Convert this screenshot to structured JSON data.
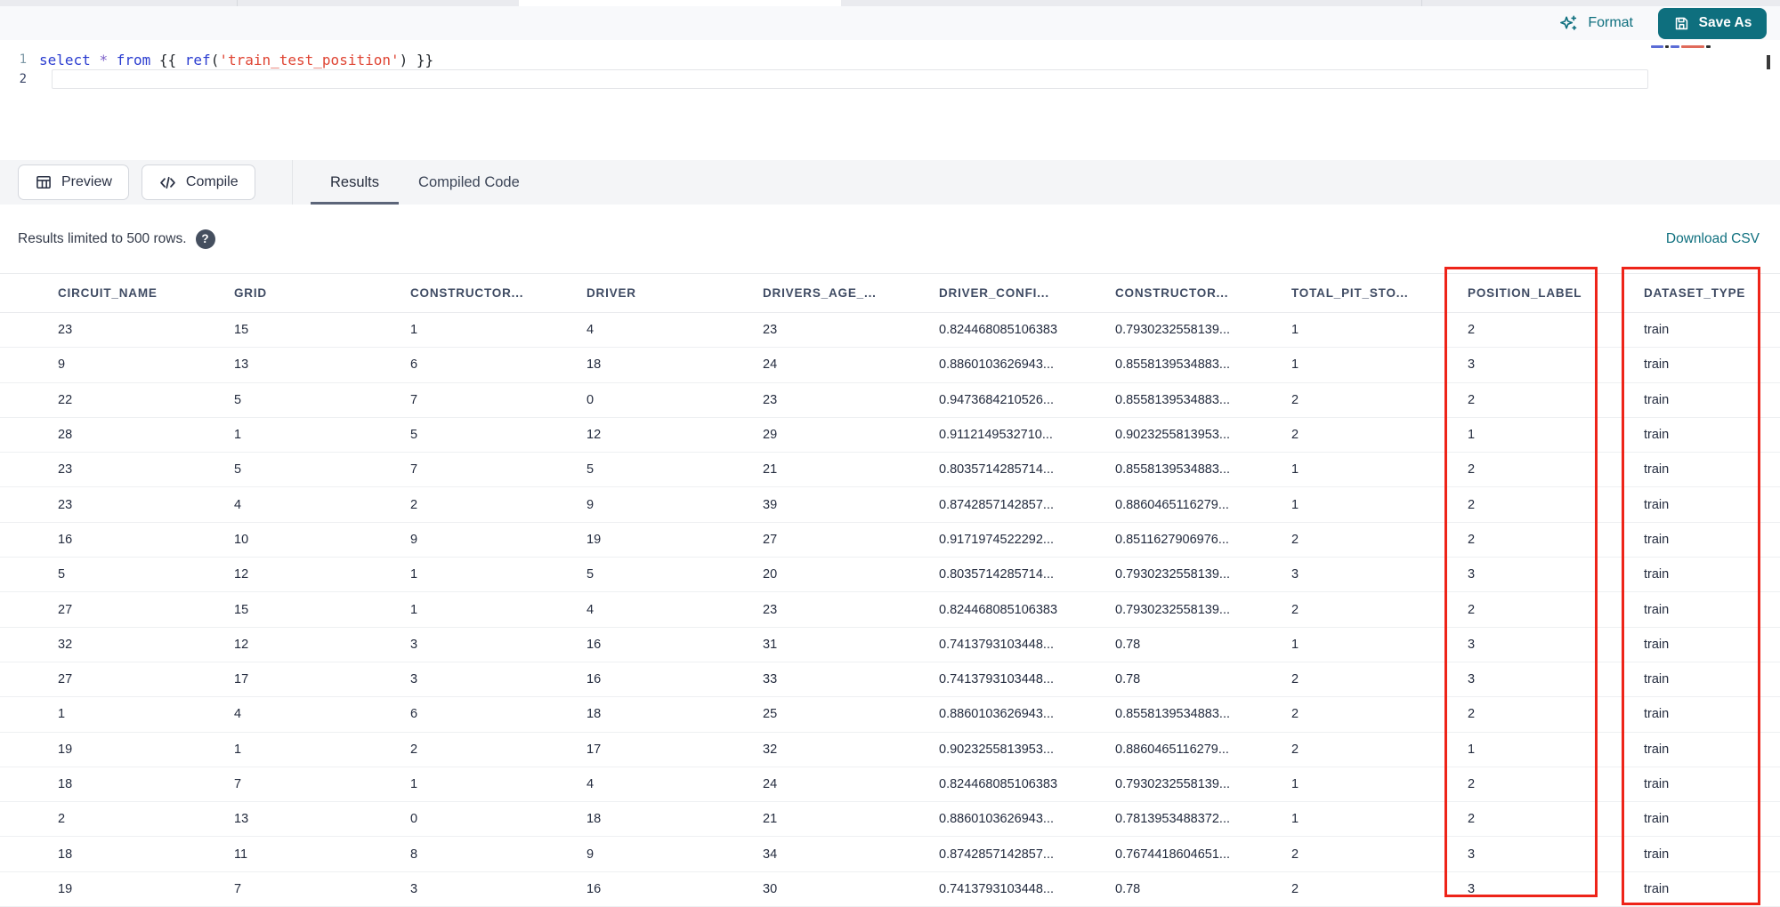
{
  "toolbar": {
    "format_label": "Format",
    "save_as_label": "Save As"
  },
  "editor": {
    "line1_number": "1",
    "line2_number": "2",
    "code_tokens": [
      {
        "text": "select",
        "type": "keyword"
      },
      {
        "text": " ",
        "type": "plain"
      },
      {
        "text": "*",
        "type": "operator"
      },
      {
        "text": " ",
        "type": "plain"
      },
      {
        "text": "from",
        "type": "keyword"
      },
      {
        "text": " {{ ",
        "type": "plain"
      },
      {
        "text": "ref",
        "type": "function"
      },
      {
        "text": "(",
        "type": "plain"
      },
      {
        "text": "'train_test_position'",
        "type": "string"
      },
      {
        "text": ")",
        "type": "plain"
      },
      {
        "text": " }}",
        "type": "plain"
      }
    ]
  },
  "actions": {
    "preview_label": "Preview",
    "compile_label": "Compile"
  },
  "tabs": {
    "results_label": "Results",
    "compiled_code_label": "Compiled Code"
  },
  "results_bar": {
    "message": "Results limited to 500 rows.",
    "help_glyph": "?",
    "download_label": "Download CSV"
  },
  "table": {
    "columns": [
      "CIRCUIT_NAME",
      "GRID",
      "CONSTRUCTOR...",
      "DRIVER",
      "DRIVERS_AGE_...",
      "DRIVER_CONFI...",
      "CONSTRUCTOR...",
      "TOTAL_PIT_STO...",
      "POSITION_LABEL",
      "DATASET_TYPE"
    ],
    "rows": [
      [
        "23",
        "15",
        "1",
        "4",
        "23",
        "0.824468085106383",
        "0.7930232558139...",
        "1",
        "2",
        "train"
      ],
      [
        "9",
        "13",
        "6",
        "18",
        "24",
        "0.8860103626943...",
        "0.8558139534883...",
        "1",
        "3",
        "train"
      ],
      [
        "22",
        "5",
        "7",
        "0",
        "23",
        "0.9473684210526...",
        "0.8558139534883...",
        "2",
        "2",
        "train"
      ],
      [
        "28",
        "1",
        "5",
        "12",
        "29",
        "0.9112149532710...",
        "0.9023255813953...",
        "2",
        "1",
        "train"
      ],
      [
        "23",
        "5",
        "7",
        "5",
        "21",
        "0.8035714285714...",
        "0.8558139534883...",
        "1",
        "2",
        "train"
      ],
      [
        "23",
        "4",
        "2",
        "9",
        "39",
        "0.8742857142857...",
        "0.8860465116279...",
        "1",
        "2",
        "train"
      ],
      [
        "16",
        "10",
        "9",
        "19",
        "27",
        "0.9171974522292...",
        "0.8511627906976...",
        "2",
        "2",
        "train"
      ],
      [
        "5",
        "12",
        "1",
        "5",
        "20",
        "0.8035714285714...",
        "0.7930232558139...",
        "3",
        "3",
        "train"
      ],
      [
        "27",
        "15",
        "1",
        "4",
        "23",
        "0.824468085106383",
        "0.7930232558139...",
        "2",
        "2",
        "train"
      ],
      [
        "32",
        "12",
        "3",
        "16",
        "31",
        "0.7413793103448...",
        "0.78",
        "1",
        "3",
        "train"
      ],
      [
        "27",
        "17",
        "3",
        "16",
        "33",
        "0.7413793103448...",
        "0.78",
        "2",
        "3",
        "train"
      ],
      [
        "1",
        "4",
        "6",
        "18",
        "25",
        "0.8860103626943...",
        "0.8558139534883...",
        "2",
        "2",
        "train"
      ],
      [
        "19",
        "1",
        "2",
        "17",
        "32",
        "0.9023255813953...",
        "0.8860465116279...",
        "2",
        "1",
        "train"
      ],
      [
        "18",
        "7",
        "1",
        "4",
        "24",
        "0.824468085106383",
        "0.7930232558139...",
        "1",
        "2",
        "train"
      ],
      [
        "2",
        "13",
        "0",
        "18",
        "21",
        "0.8860103626943...",
        "0.7813953488372...",
        "1",
        "2",
        "train"
      ],
      [
        "18",
        "11",
        "8",
        "9",
        "34",
        "0.8742857142857...",
        "0.7674418604651...",
        "2",
        "3",
        "train"
      ],
      [
        "19",
        "7",
        "3",
        "16",
        "30",
        "0.7413793103448...",
        "0.78",
        "2",
        "3",
        "train"
      ]
    ]
  },
  "annotations": {
    "highlighted_columns": [
      "POSITION_LABEL",
      "DATASET_TYPE"
    ],
    "highlight_color": "#ee2419"
  },
  "colors": {
    "accent_teal": "#0e6f7e",
    "annotation_red": "#ee2419",
    "keyword_blue": "#2a3cd0",
    "string_red": "#df4433"
  }
}
